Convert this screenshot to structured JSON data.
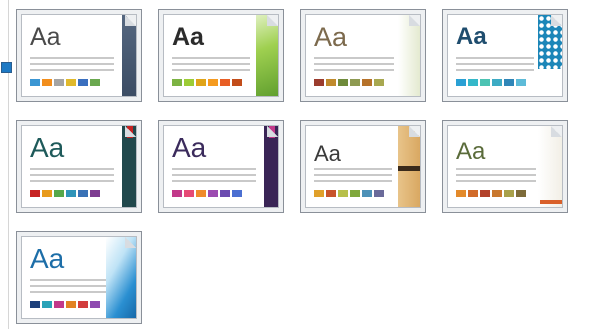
{
  "themes": [
    {
      "sample": "Aa",
      "text_color": "#4a4a4a",
      "accent": "slate-bar",
      "swatches": [
        "#3b96d3",
        "#f28e1c",
        "#a4a4a4",
        "#e0b92c",
        "#3a6fbf",
        "#6aa84f"
      ]
    },
    {
      "sample": "Aa",
      "text_color": "#2b2b2b",
      "accent": "green-leaf",
      "swatches": [
        "#7cb342",
        "#9ccc35",
        "#e0a419",
        "#f59b20",
        "#e85e25",
        "#c24d1a"
      ]
    },
    {
      "sample": "Aa",
      "text_color": "#7c6a4d",
      "accent": "cream-fade",
      "swatches": [
        "#9b3c2e",
        "#c08a2d",
        "#6f8b3b",
        "#8e9a52",
        "#b6722a",
        "#a8a850"
      ]
    },
    {
      "sample": "Aa",
      "text_color": "#1f4d6e",
      "accent": "blue-pattern",
      "swatches": [
        "#2aa0d4",
        "#35b8c9",
        "#4cc3b3",
        "#3dabc4",
        "#2f86b8",
        "#5dbbd8"
      ]
    },
    {
      "sample": "Aa",
      "text_color": "#1e5a5a",
      "accent": "teal-ribbon",
      "swatches": [
        "#c72323",
        "#e89b1c",
        "#56a84a",
        "#2f94b9",
        "#3a72b6",
        "#7e3d91"
      ]
    },
    {
      "sample": "Aa",
      "text_color": "#3b2b5c",
      "accent": "purple-ribbon",
      "swatches": [
        "#c2398a",
        "#e64a76",
        "#f08b2b",
        "#9c4bb0",
        "#6b4bb0",
        "#4b6fd1"
      ]
    },
    {
      "sample": "Aa",
      "text_color": "#3a3a3a",
      "accent": "wood-band",
      "swatches": [
        "#e0a02a",
        "#c8542a",
        "#b7c04a",
        "#7fa83c",
        "#4d91b8",
        "#6a6a9a"
      ]
    },
    {
      "sample": "Aa",
      "text_color": "#5a6b3a",
      "accent": "orange-strip",
      "swatches": [
        "#e38a2a",
        "#d16b2a",
        "#b2412a",
        "#c9782e",
        "#a8a04a",
        "#7d6b3a"
      ]
    },
    {
      "sample": "Aa",
      "text_color": "#1d6ea8",
      "accent": "blue-diagonal",
      "swatches": [
        "#1c3f7a",
        "#2aa3b8",
        "#c2398a",
        "#e28222",
        "#d23d3d",
        "#8e4ab0"
      ]
    }
  ]
}
